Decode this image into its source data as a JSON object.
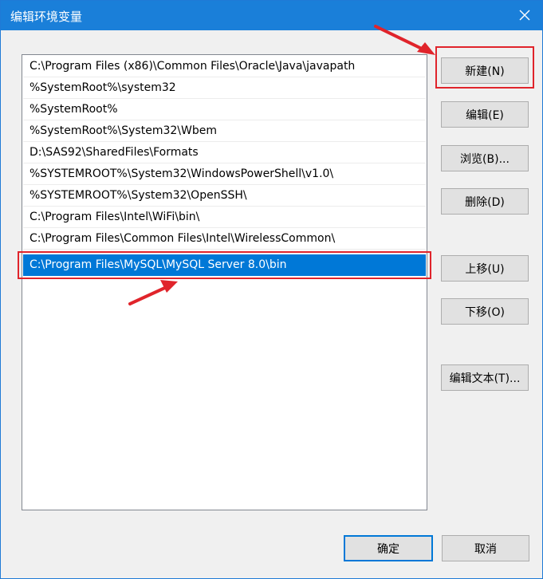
{
  "window": {
    "title": "编辑环境变量",
    "accent_color": "#1a7fd9",
    "selection_color": "#0078d7",
    "annotation_color": "#e0242b"
  },
  "paths": [
    "C:\\Program Files (x86)\\Common Files\\Oracle\\Java\\javapath",
    "%SystemRoot%\\system32",
    "%SystemRoot%",
    "%SystemRoot%\\System32\\Wbem",
    "D:\\SAS92\\SharedFiles\\Formats",
    "%SYSTEMROOT%\\System32\\WindowsPowerShell\\v1.0\\",
    "%SYSTEMROOT%\\System32\\OpenSSH\\",
    "C:\\Program Files\\Intel\\WiFi\\bin\\",
    "C:\\Program Files\\Common Files\\Intel\\WirelessCommon\\",
    "C:\\Program Files\\MySQL\\MySQL Server 8.0\\bin"
  ],
  "selected_index": 9,
  "buttons": {
    "new": "新建(N)",
    "edit": "编辑(E)",
    "browse": "浏览(B)...",
    "delete": "删除(D)",
    "move_up": "上移(U)",
    "move_down": "下移(O)",
    "edit_text": "编辑文本(T)...",
    "ok": "确定",
    "cancel": "取消"
  }
}
